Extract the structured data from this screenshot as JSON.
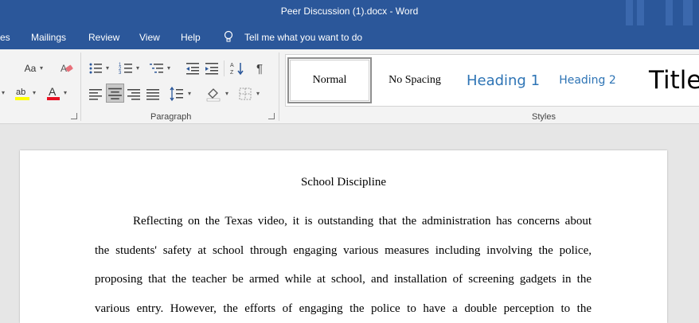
{
  "titlebar": {
    "title": "Peer Discussion (1).docx  -  Word"
  },
  "menu": {
    "items": [
      "es",
      "Mailings",
      "Review",
      "View",
      "Help"
    ],
    "tell_me": "Tell me what you want to do"
  },
  "ribbon": {
    "font_size_button": "Aa",
    "paragraph_label": "Paragraph",
    "styles_label": "Styles",
    "styles": [
      "Normal",
      "No Spacing",
      "Heading 1",
      "Heading 2",
      "Title"
    ],
    "colors": {
      "highlight": "#ffff00",
      "font_color": "#e81123",
      "accent": "#2b579a"
    }
  },
  "document": {
    "title": "School Discipline",
    "lines": [
      "Reflecting on the Texas video, it is outstanding that the administration has concerns about",
      "the students' safety at school through engaging various measures including involving the police,",
      "proposing that the teacher be armed while at school, and installation of screening gadgets in the",
      "various entry. However, the efforts of engaging the police to have a double perception to the"
    ]
  }
}
